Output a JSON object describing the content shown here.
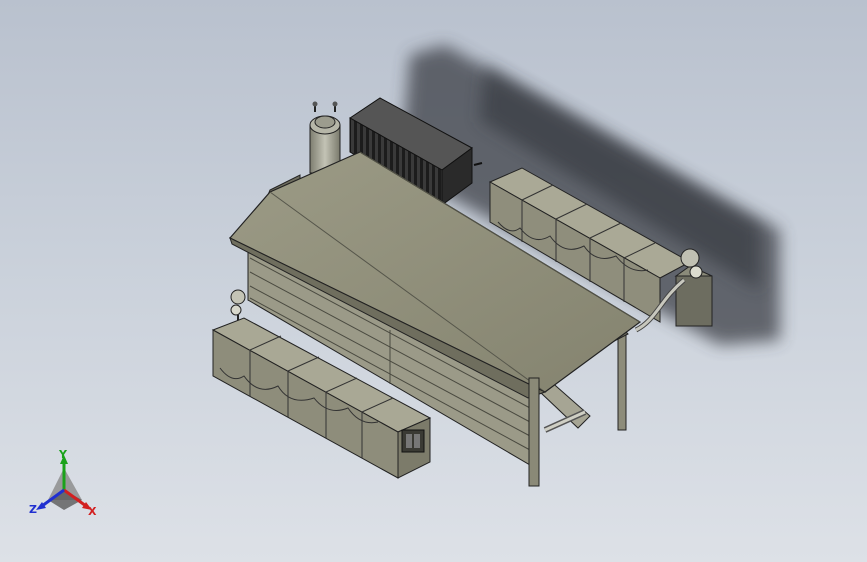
{
  "triad": {
    "x_label": "X",
    "y_label": "Y",
    "z_label": "Z",
    "x_color": "#d22020",
    "y_color": "#1aa21a",
    "z_color": "#2030d0"
  },
  "model": {
    "roof_color": "#8e8d78",
    "wall_color": "#9a9a88",
    "tank_color": "#a8a89a",
    "cooler_color": "#2a2a2a",
    "shadow_color": "#404449"
  }
}
